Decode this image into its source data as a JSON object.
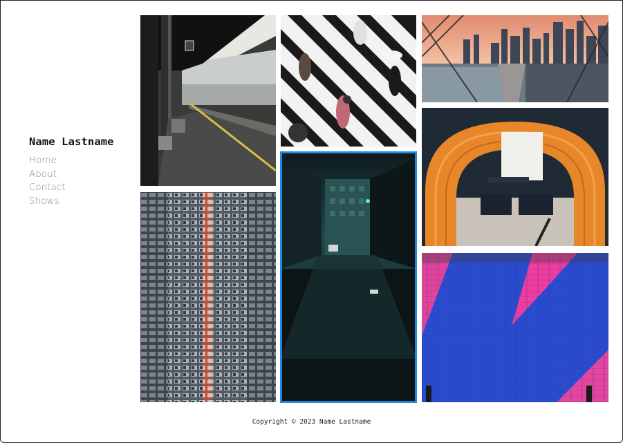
{
  "site": {
    "name": "Name Lastname"
  },
  "nav": {
    "items": [
      {
        "label": "Home"
      },
      {
        "label": "About"
      },
      {
        "label": "Contact"
      },
      {
        "label": "Shows"
      }
    ]
  },
  "gallery": {
    "photos": [
      {
        "subject": "train-station-platform"
      },
      {
        "subject": "pedestrian-crosswalk"
      },
      {
        "subject": "city-skyline-through-fence"
      },
      {
        "subject": "orange-subway-tunnel"
      },
      {
        "subject": "dense-apartment-block"
      },
      {
        "subject": "dark-neon-alley",
        "selected": true
      },
      {
        "subject": "blue-pink-painted-wall"
      }
    ],
    "selection_color": "#1e88e5"
  },
  "footer": {
    "copyright": "Copyright © 2023 Name Lastname"
  }
}
